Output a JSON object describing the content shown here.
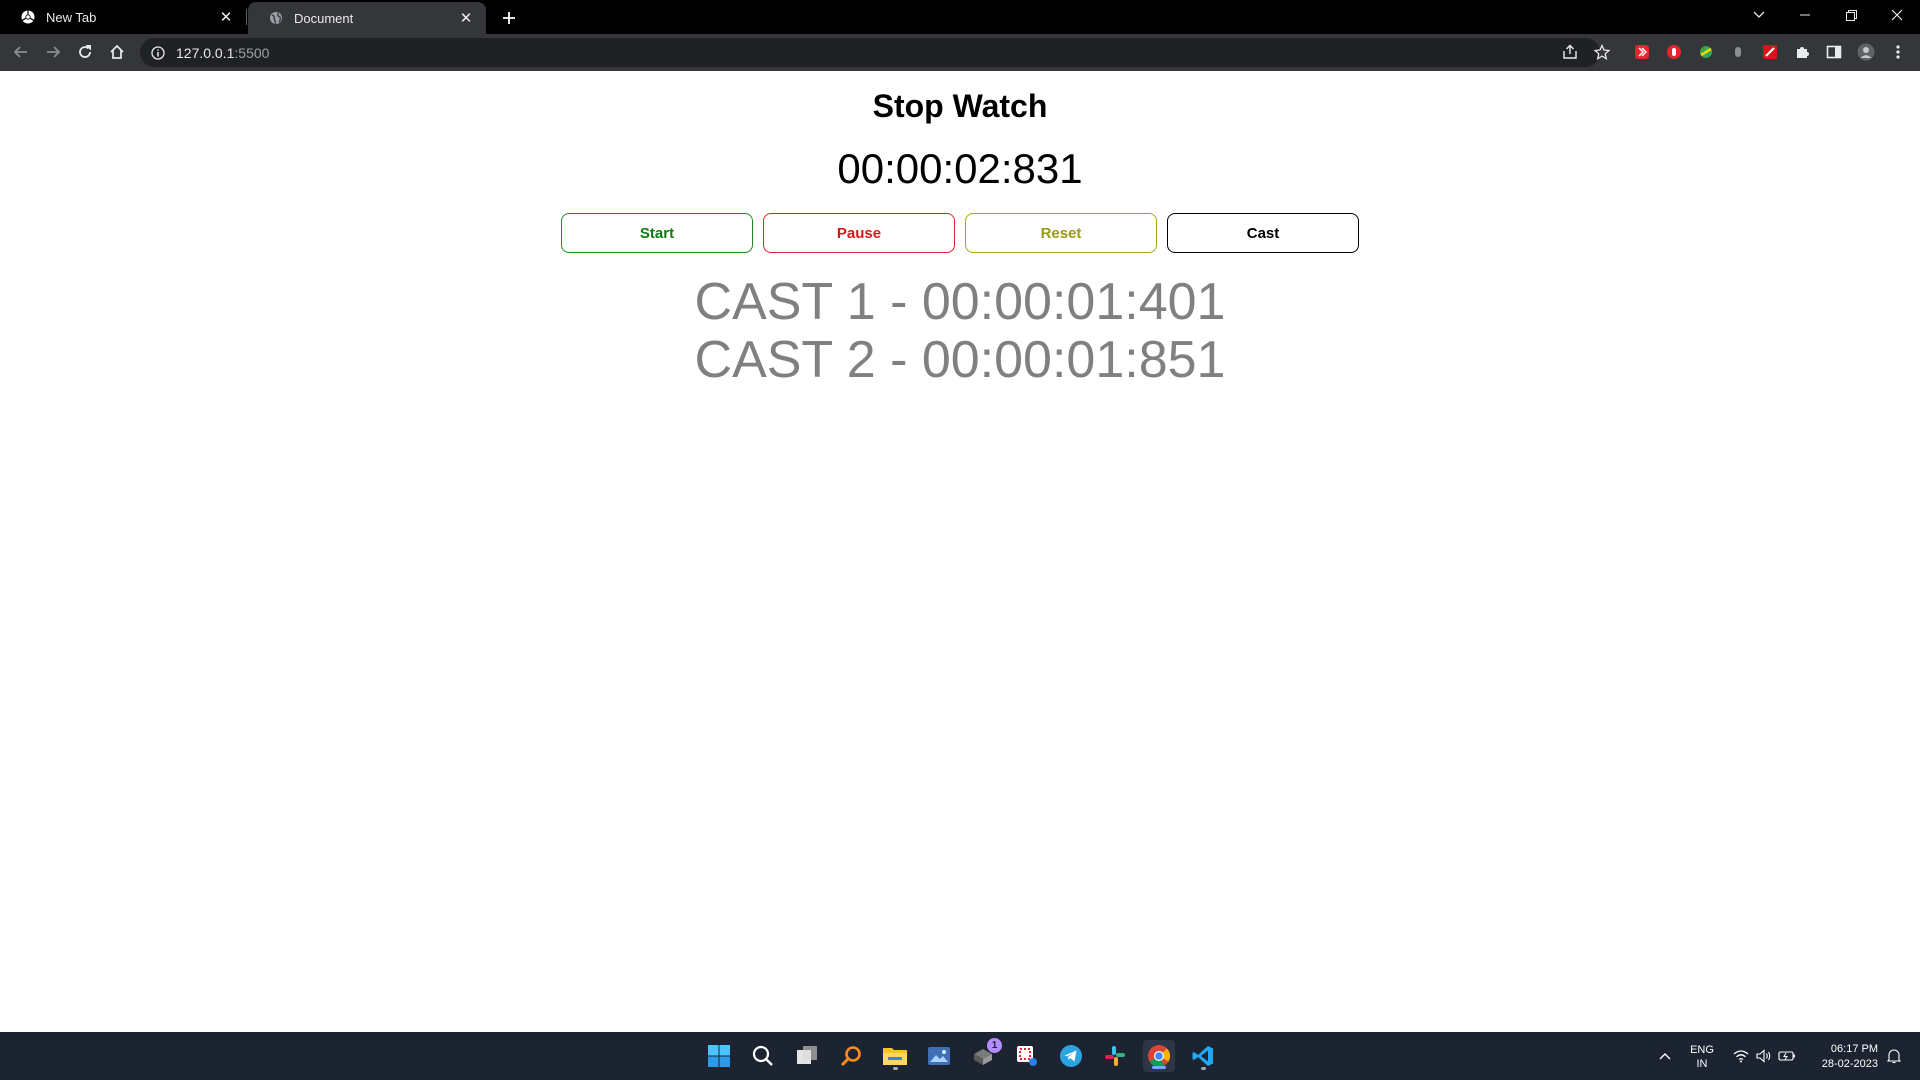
{
  "browser": {
    "tabs": [
      {
        "title": "New Tab",
        "icon": "chrome-icon"
      },
      {
        "title": "Document",
        "icon": "globe-icon",
        "active": true
      }
    ],
    "url_host": "127.0.0.1",
    "url_port": ":5500"
  },
  "page": {
    "title": "Stop Watch",
    "timer": "00:00:02:831",
    "buttons": {
      "start": "Start",
      "pause": "Pause",
      "reset": "Reset",
      "cast": "Cast"
    },
    "casts": [
      "CAST 1 - 00:00:01:401",
      "CAST 2 - 00:00:01:851"
    ]
  },
  "colors": {
    "start": "#0f7a0f",
    "pause": "#d61a1a",
    "reset": "#9a9a14",
    "cast": "#000000",
    "cast_text": "#808080"
  },
  "taskbar": {
    "apps": [
      "windows-start-icon",
      "search-icon",
      "task-view-icon",
      "search-tool-icon",
      "file-explorer-icon",
      "photos-icon",
      "app-with-badge-icon",
      "snipping-tool-icon",
      "telegram-icon",
      "slack-icon",
      "chrome-icon",
      "vscode-icon"
    ],
    "badge": "1",
    "language_line1": "ENG",
    "language_line2": "IN",
    "time": "06:17 PM",
    "date": "28-02-2023"
  }
}
